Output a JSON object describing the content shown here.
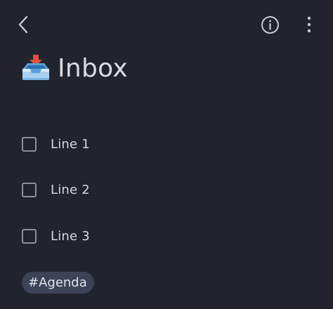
{
  "header": {
    "back_icon": "chevron-left-icon",
    "info_icon": "info-circle-icon",
    "more_icon": "more-vertical-icon"
  },
  "page": {
    "title": "Inbox",
    "title_icon": "inbox-tray-icon"
  },
  "tasks": [
    {
      "label": "Line 1",
      "checked": false
    },
    {
      "label": "Line 2",
      "checked": false
    },
    {
      "label": "Line 3",
      "checked": false
    }
  ],
  "tags": [
    {
      "label": "#Agenda"
    }
  ],
  "colors": {
    "background": "#21232e",
    "text": "#d6d8de",
    "tag_background": "#3d4256",
    "icon": "#c7cad3"
  }
}
